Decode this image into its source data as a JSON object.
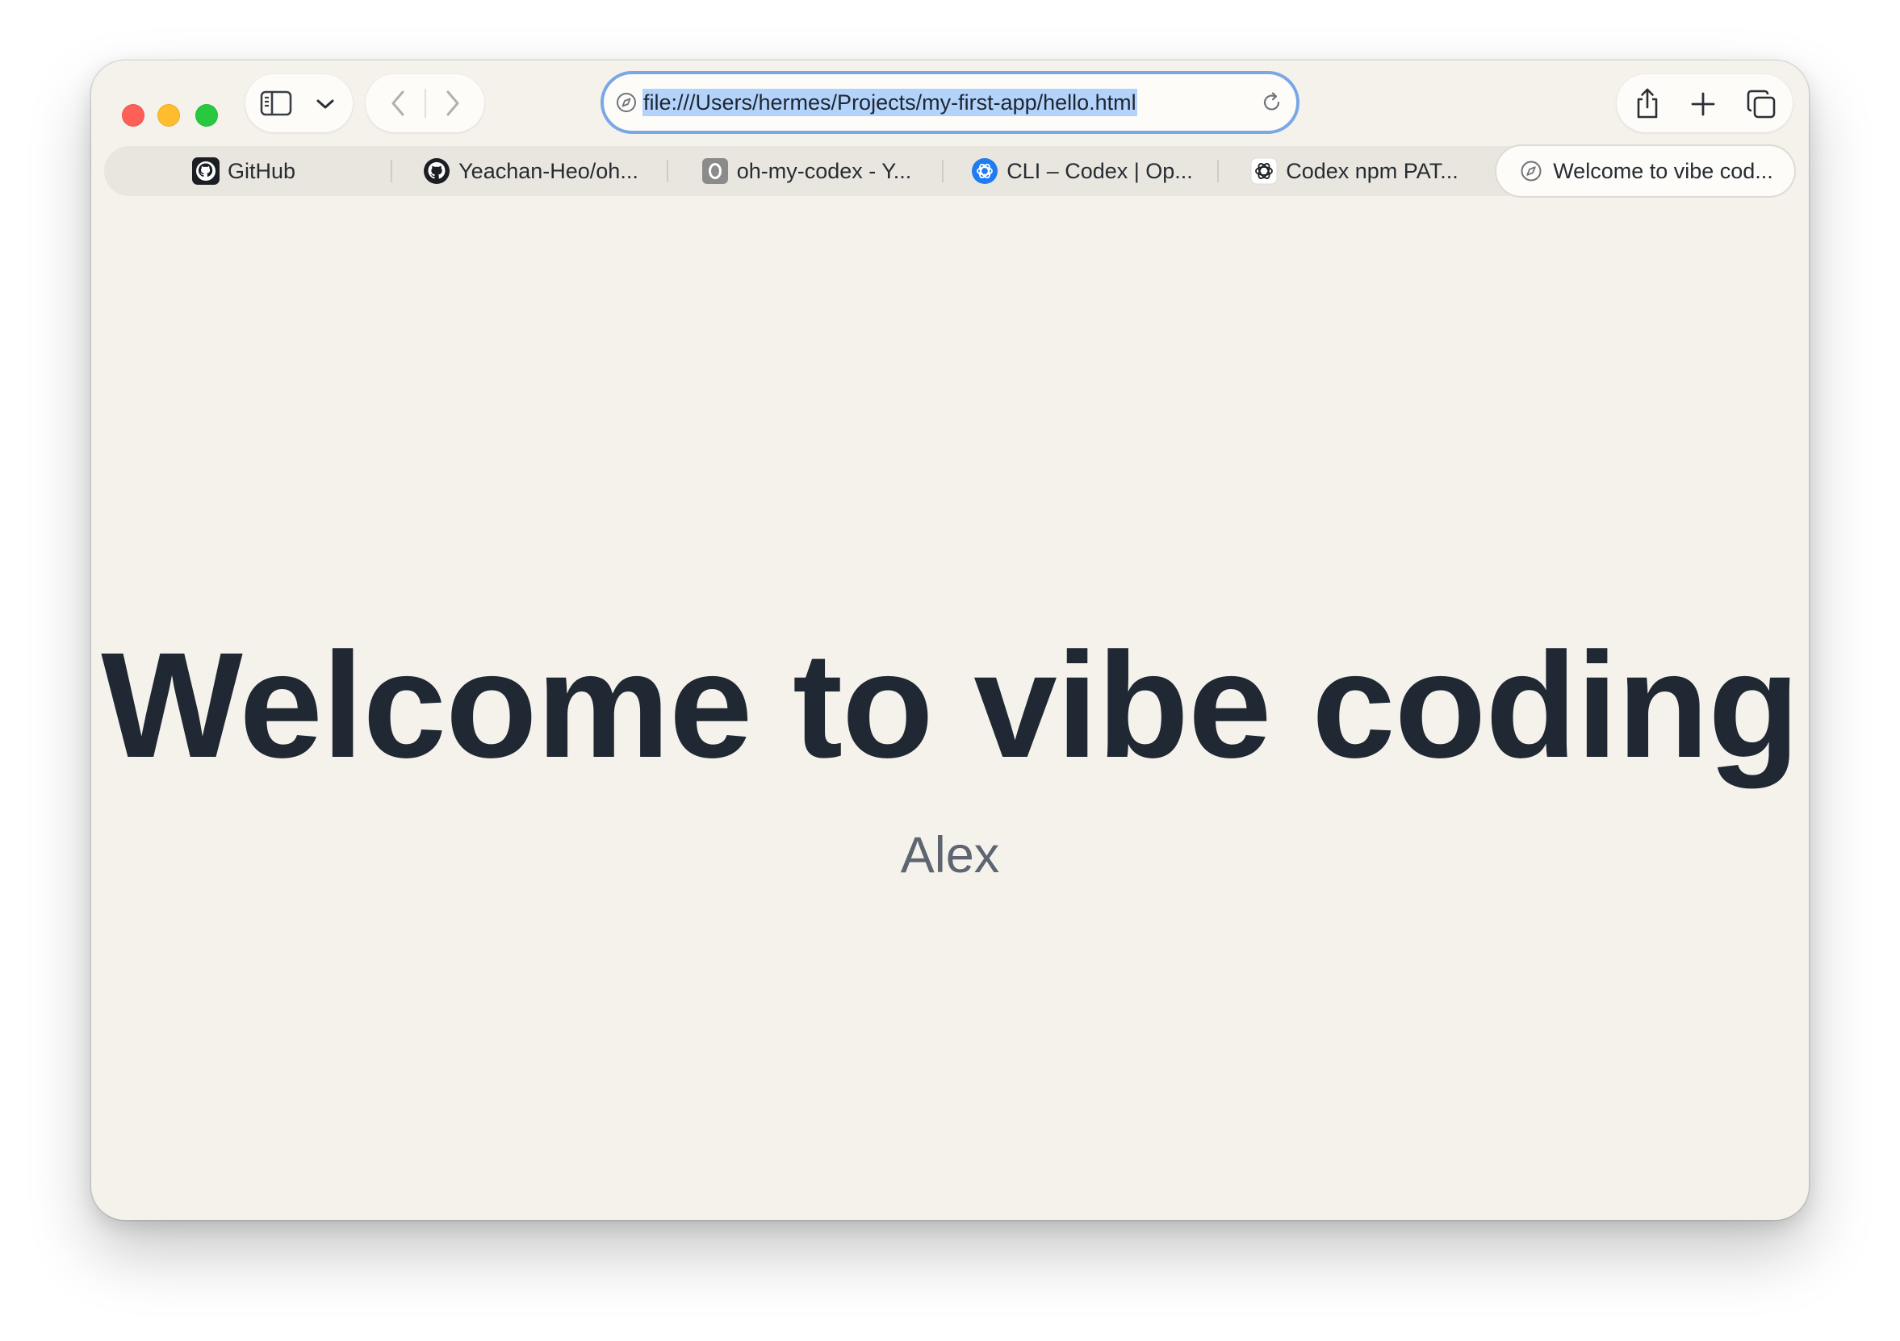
{
  "browser": {
    "address_bar": {
      "url": "file:///Users/hermes/Projects/my-first-app/hello.html",
      "site_icon": "compass-icon",
      "reload_icon": "reload-icon"
    },
    "toolbar_icons": {
      "sidebar": "sidebar-icon",
      "sidebar_menu": "chevron-down-icon",
      "back": "back-icon",
      "forward": "forward-icon",
      "share": "share-icon",
      "new_tab": "plus-icon",
      "tab_overview": "tab-overview-icon"
    },
    "tabs": [
      {
        "label": "GitHub",
        "icon": "github-icon",
        "active": false
      },
      {
        "label": "Yeachan-Heo/oh...",
        "icon": "github-icon",
        "active": false
      },
      {
        "label": "oh-my-codex - Y...",
        "icon": "letter-o-icon",
        "active": false
      },
      {
        "label": "CLI – Codex | Op...",
        "icon": "openai-blue-icon",
        "active": false
      },
      {
        "label": "Codex npm PAT...",
        "icon": "openai-icon",
        "active": false
      },
      {
        "label": "Welcome to vibe cod...",
        "icon": "compass-icon",
        "active": true
      }
    ],
    "colors": {
      "window_bg": "#f5f2ec",
      "address_focus_ring": "#7aa7e6",
      "url_selection": "#b3d3fb",
      "close": "#fe5f57",
      "minimize": "#febc2e",
      "zoom": "#28c840"
    }
  },
  "page": {
    "headline": "Welcome to vibe coding",
    "subtitle": "Alex",
    "colors": {
      "headline": "#1f2833",
      "subtitle": "#5d6670"
    }
  }
}
